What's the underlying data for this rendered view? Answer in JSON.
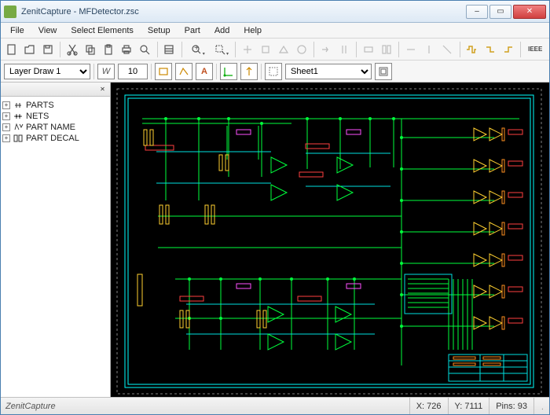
{
  "titlebar": {
    "title": "ZenitCapture - MFDetector.zsc"
  },
  "menu": {
    "items": [
      "File",
      "View",
      "Select Elements",
      "Setup",
      "Part",
      "Add",
      "Help"
    ]
  },
  "toolbar2": {
    "layer_options": [
      "Layer Draw 1"
    ],
    "layer_selected": "Layer Draw 1",
    "width_label": "W",
    "width_value": "10",
    "sheet_options": [
      "Sheet1"
    ],
    "sheet_selected": "Sheet1"
  },
  "tree": {
    "items": [
      {
        "label": "PARTS"
      },
      {
        "label": "NETS"
      },
      {
        "label": "PART NAME"
      },
      {
        "label": "PART DECAL"
      }
    ]
  },
  "status": {
    "app": "ZenitCapture",
    "x_label": "X:",
    "x_value": "726",
    "y_label": "Y:",
    "y_value": "7111",
    "pins_label": "Pins:",
    "pins_value": "93"
  },
  "colors": {
    "board_outline": "#00ffff",
    "trace_green": "#00ff3c",
    "trace_cyan": "#00e0e0",
    "comp_red": "#ff4040",
    "comp_yellow": "#ffd030",
    "comp_magenta": "#ff50ff",
    "comp_orange": "#ff9020",
    "grid_dash": "#808080"
  }
}
